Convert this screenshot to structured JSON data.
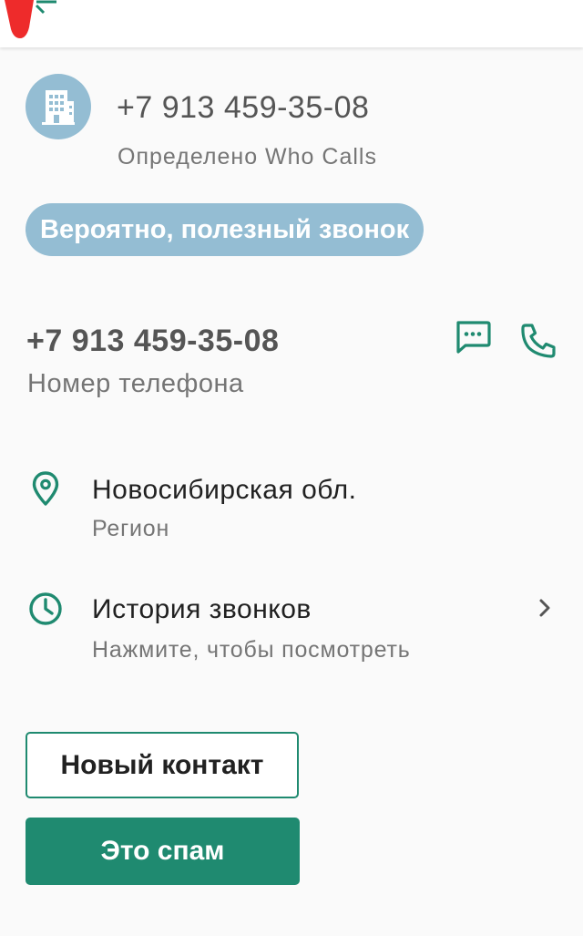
{
  "header": {
    "phone_number": "+7 913 459-35-08",
    "source": "Определено Who Calls",
    "avatar_icon": "building-icon"
  },
  "status": {
    "label": "Вероятно, полезный звонок"
  },
  "phone": {
    "number": "+7 913 459-35-08",
    "label": "Номер телефона",
    "actions": [
      "message-icon",
      "call-icon"
    ]
  },
  "region": {
    "title": "Новосибирская обл.",
    "subtitle": "Регион",
    "icon": "location-pin-icon"
  },
  "history": {
    "title": "История звонков",
    "subtitle": "Нажмите, чтобы посмотреть",
    "icon": "clock-icon"
  },
  "buttons": {
    "new_contact": "Новый контакт",
    "spam": "Это спам"
  },
  "colors": {
    "accent": "#1f8a70",
    "avatar_bg": "#94bdd3",
    "pill_bg": "#94bdd3",
    "back_marker": "#ee2b2b"
  }
}
